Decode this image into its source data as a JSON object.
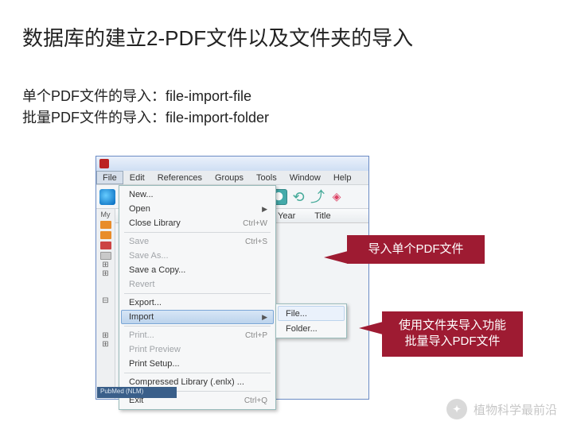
{
  "heading": "数据库的建立2-PDF文件以及文件夹的导入",
  "subtitle_line1": "单个PDF文件的导入：file-import-file",
  "subtitle_line2": "批量PDF文件的导入：file-import-folder",
  "menubar": [
    "File",
    "Edit",
    "References",
    "Groups",
    "Tools",
    "Window",
    "Help"
  ],
  "columns": {
    "year": "Year",
    "title": "Title"
  },
  "sidebar_label": "My",
  "file_menu": {
    "new": "New...",
    "open": "Open",
    "close": "Close Library",
    "close_sc": "Ctrl+W",
    "save": "Save",
    "save_sc": "Ctrl+S",
    "saveas": "Save As...",
    "savecopy": "Save a Copy...",
    "revert": "Revert",
    "export": "Export...",
    "import": "Import",
    "print": "Print...",
    "print_sc": "Ctrl+P",
    "printpreview": "Print Preview",
    "printsetup": "Print Setup...",
    "compressed": "Compressed Library (.enlx) ...",
    "exit": "Exit",
    "exit_sc": "Ctrl+Q"
  },
  "submenu": {
    "file": "File...",
    "folder": "Folder..."
  },
  "callout1": "导入单个PDF文件",
  "callout2_l1": "使用文件夹导入功能",
  "callout2_l2": "批量导入PDF文件",
  "pubbar": "PubMed (NLM)",
  "watermark": "植物科学最前沿"
}
